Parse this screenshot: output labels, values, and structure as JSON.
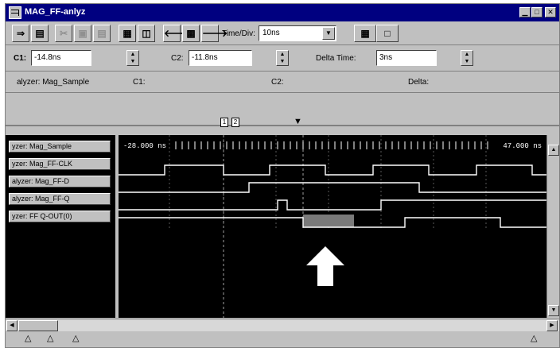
{
  "window": {
    "title": "MAG_FF-anlyz",
    "minimize_icon": "minimize-icon",
    "maximize_icon": "maximize-icon",
    "close_icon": "close-icon"
  },
  "toolbar": {
    "time_div_label": "Time/Div:",
    "time_div_value": "10ns"
  },
  "cursors": {
    "c1_label": "C1:",
    "c1_value": "-14.8ns",
    "c2_label": "C2:",
    "c2_value": "-11.8ns",
    "delta_label": "Delta Time:",
    "delta_value": "3ns"
  },
  "info": {
    "analyzer": "alyzer: Mag_Sample",
    "c1": "C1:",
    "c2": "C2:",
    "delta": "Delta:"
  },
  "waveform": {
    "time_left": "-28.000 ns",
    "time_right": "47.000 ns",
    "signals": [
      "yzer: Mag_Sample",
      "yzer: Mag_FF-CLK",
      "alyzer: Mag_FF-D",
      "alyzer: Mag_FF-Q",
      "yzer: FF Q-OUT(0)"
    ]
  },
  "colors": {
    "background": "#000000",
    "trace": "#ffffff",
    "highlight": "#7a7a7a",
    "titlebar": "#000080",
    "face": "#c0c0c0"
  },
  "annotation": {
    "arrow": "up-arrow-icon"
  }
}
